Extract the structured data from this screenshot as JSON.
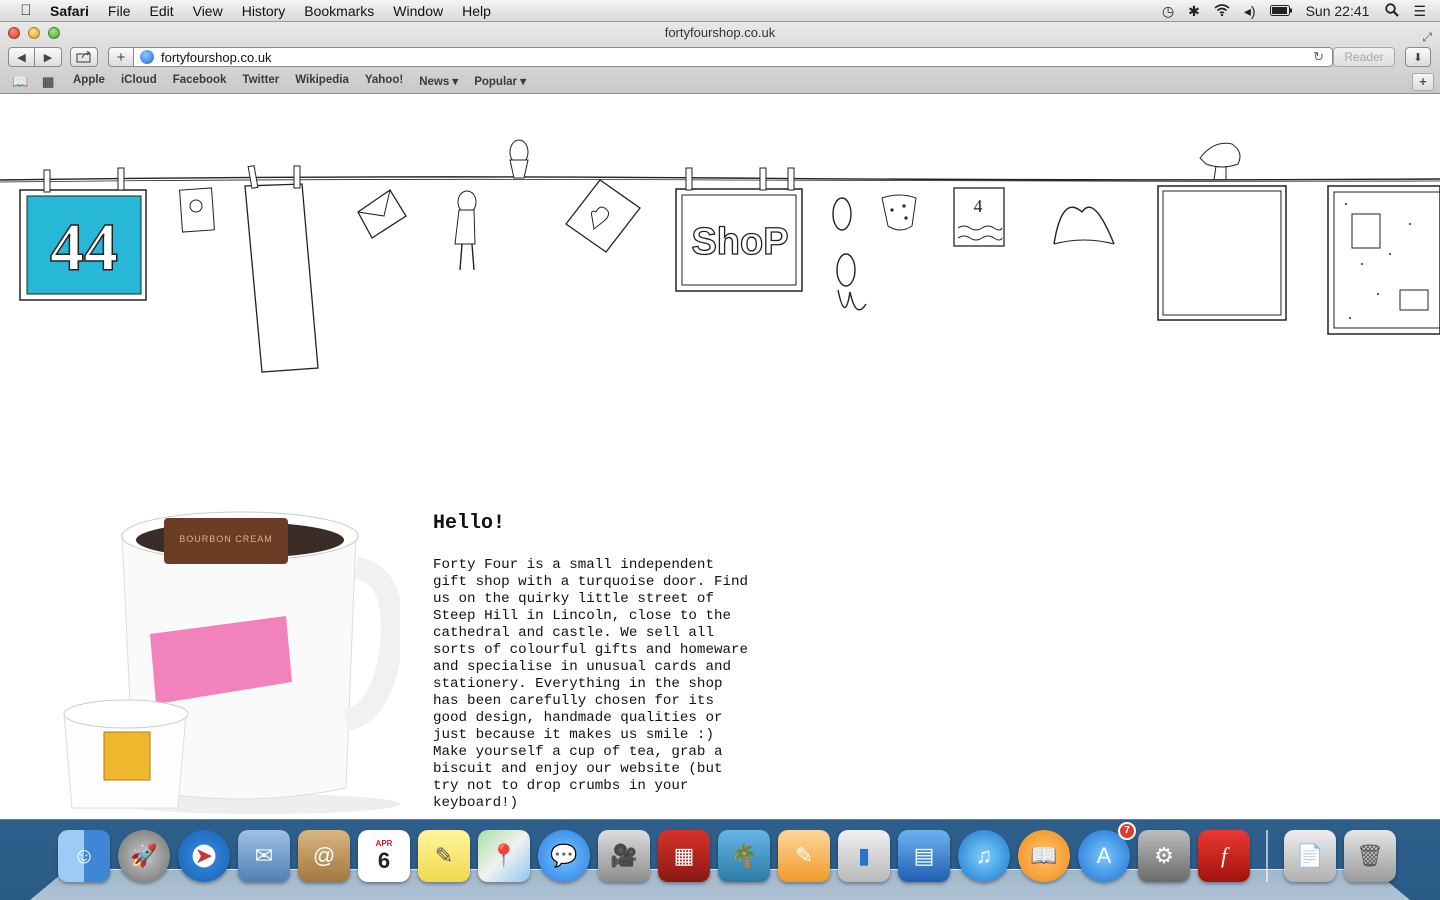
{
  "menubar": {
    "app_name": "Safari",
    "items": [
      "File",
      "Edit",
      "View",
      "History",
      "Bookmarks",
      "Window",
      "Help"
    ],
    "clock": "Sun 22:41"
  },
  "window": {
    "title": "fortyfourshop.co.uk",
    "url": "fortyfourshop.co.uk",
    "reader_label": "Reader"
  },
  "bookmarks": [
    "Apple",
    "iCloud",
    "Facebook",
    "Twitter",
    "Wikipedia",
    "Yahoo!",
    "News ▾",
    "Popular ▾"
  ],
  "page": {
    "logo_text": "44",
    "shop_sign": "ShoP",
    "heading": "Hello!",
    "body": "Forty Four is a small independent\ngift shop with a turquoise door. Find\nus on the quirky little street of\nSteep Hill in Lincoln, close to the\ncathedral and castle. We sell all\nsorts of colourful gifts and homeware\nand specialise in unusual cards and\nstationery. Everything in the shop\nhas been carefully chosen for its\ngood design, handmade qualities or\njust because it makes us smile :)\nMake yourself a cup of tea, grab a\nbiscuit and enjoy our website (but\ntry not to drop crumbs in your\nkeyboard!)",
    "mug_print": "BOURBON CREAM",
    "accent_turquoise": "#27b8d8",
    "accent_pink": "#f06cb0"
  },
  "dock": {
    "calendar_month": "APR",
    "calendar_day": "6",
    "appstore_badge": "7",
    "items": [
      "finder-icon",
      "launchpad-icon",
      "safari-icon",
      "mail-icon",
      "contacts-icon",
      "calendar-icon",
      "notes-icon",
      "maps-icon",
      "messages-icon",
      "facetime-icon",
      "photo-booth-icon",
      "iphoto-icon",
      "pages-icon",
      "numbers-icon",
      "keynote-icon",
      "itunes-icon",
      "ibooks-icon",
      "app-store-icon",
      "system-preferences-icon",
      "flash-icon",
      "documents-icon",
      "trash-icon"
    ]
  }
}
